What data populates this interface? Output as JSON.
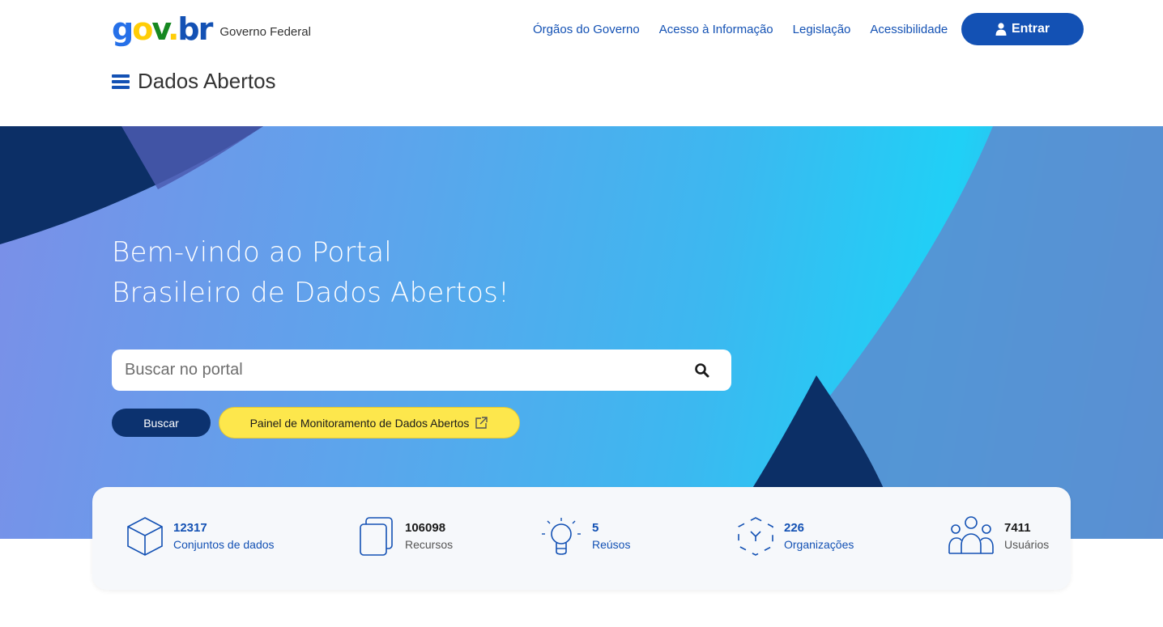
{
  "header": {
    "gov_name": "Governo Federal",
    "nav": [
      "Órgãos do Governo",
      "Acesso à Informação",
      "Legislação",
      "Acessibilidade"
    ],
    "login_label": "Entrar",
    "site_title": "Dados Abertos"
  },
  "logo": {
    "g": "g",
    "o": "o",
    "v": "v",
    "dot": ".",
    "b": "b",
    "r": "r"
  },
  "hero": {
    "title_line1": "Bem-vindo ao Portal",
    "title_line2": "Brasileiro de Dados Abertos!",
    "search_placeholder": "Buscar no portal",
    "search_button": "Buscar",
    "monitor_button": "Painel de Monitoramento de Dados Abertos"
  },
  "stats": [
    {
      "value": "12317",
      "label": "Conjuntos de dados",
      "icon": "cube-icon"
    },
    {
      "value": "106098",
      "label": "Recursos",
      "icon": "documents-icon"
    },
    {
      "value": "5",
      "label": "Reúsos",
      "icon": "lightbulb-icon"
    },
    {
      "value": "226",
      "label": "Organizações",
      "icon": "network-icon"
    },
    {
      "value": "7411",
      "label": "Usuários",
      "icon": "users-icon"
    }
  ],
  "colors": {
    "primary": "#1351b4",
    "dark_blue": "#0c326f",
    "yellow": "#fde74c"
  }
}
